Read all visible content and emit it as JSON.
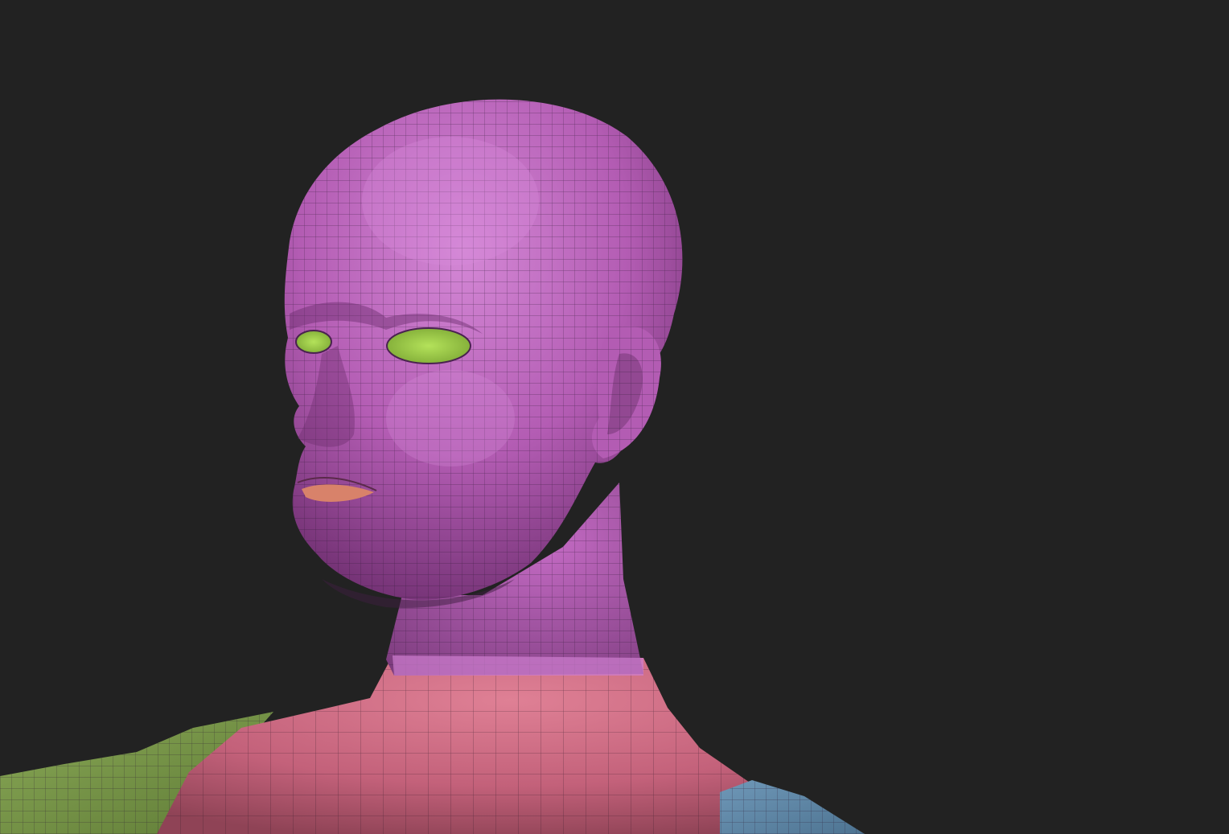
{
  "scene": {
    "background": "#222222",
    "polygroups": {
      "head": "#b35cb3",
      "head_highlight": "#cf7fd0",
      "eyes": "#9ccc44",
      "lips": "#d8826a",
      "torso": "#c3617a",
      "torso_highlight": "#df8095",
      "shoulder_left": "#7d9a4c",
      "shoulder_right": "#5f87a6"
    },
    "wireframe_color": "#2a1830",
    "wireframe_visible": true
  }
}
